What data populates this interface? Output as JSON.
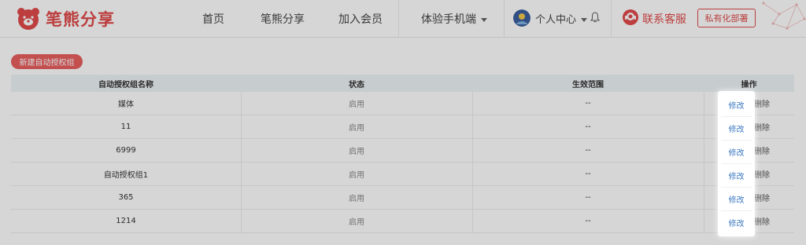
{
  "header": {
    "brand": "笔熊分享",
    "nav": {
      "home": "首页",
      "share": "笔熊分享",
      "join": "加入会员",
      "mobile": "体验手机端"
    },
    "user_center": "个人中心",
    "customer_service": "联系客服",
    "private_deploy": "私有化部署",
    "accent_color": "#e04a4a"
  },
  "toolbar": {
    "new_group": "新建自动授权组"
  },
  "table": {
    "columns": [
      "自动授权组名称",
      "状态",
      "生效范围",
      "操作"
    ],
    "rows": [
      {
        "name": "媒体",
        "status": "启用",
        "scope": "--",
        "edit": "修改",
        "delete": "删除"
      },
      {
        "name": "11",
        "status": "启用",
        "scope": "--",
        "edit": "修改",
        "delete": "删除"
      },
      {
        "name": "6999",
        "status": "启用",
        "scope": "--",
        "edit": "修改",
        "delete": "删除"
      },
      {
        "name": "自动授权组1",
        "status": "启用",
        "scope": "--",
        "edit": "修改",
        "delete": "删除"
      },
      {
        "name": "365",
        "status": "启用",
        "scope": "--",
        "edit": "修改",
        "delete": "删除"
      },
      {
        "name": "1214",
        "status": "启用",
        "scope": "--",
        "edit": "修改",
        "delete": "删除"
      }
    ]
  }
}
